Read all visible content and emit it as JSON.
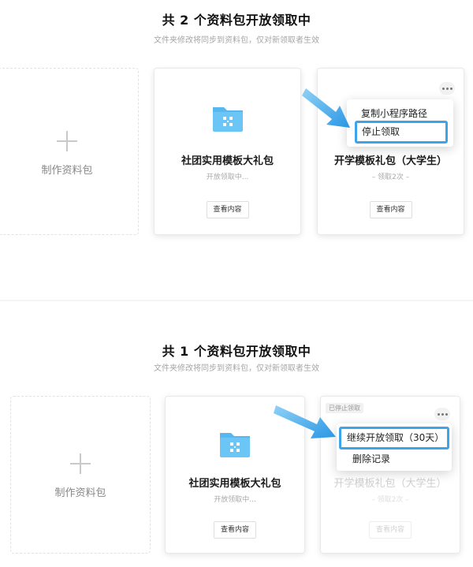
{
  "top": {
    "heading": "共 2 个资料包开放领取中",
    "subheading": "文件夹修改将同步到资料包，仅对新领取者生效",
    "create_card": {
      "label": "制作资料包"
    },
    "card1": {
      "title": "社团实用模板大礼包",
      "status": "开放领取中...",
      "view_label": "查看内容",
      "icon": "folder-icon"
    },
    "card2": {
      "title": "开学模板礼包（大学生）",
      "status": "– 领取2次 –",
      "view_label": "查看内容",
      "menu": {
        "items": [
          "复制小程序路径",
          "停止领取"
        ]
      }
    }
  },
  "bottom": {
    "heading": "共 1 个资料包开放领取中",
    "subheading": "文件夹修改将同步到资料包，仅对新领取者生效",
    "create_card": {
      "label": "制作资料包"
    },
    "card1": {
      "title": "社团实用模板大礼包",
      "status": "开放领取中...",
      "view_label": "查看内容",
      "icon": "folder-icon"
    },
    "card2": {
      "badge": "已停止领取",
      "title": "开学模板礼包（大学生）",
      "status": "– 领取2次 –",
      "view_label": "查看内容",
      "menu": {
        "items": [
          "继续开放领取（30天）",
          "删除记录"
        ]
      }
    }
  },
  "colors": {
    "accent": "#3ea4e8",
    "folder": "#56b8ee",
    "heading": "#111111",
    "muted": "#a6a6a6"
  }
}
